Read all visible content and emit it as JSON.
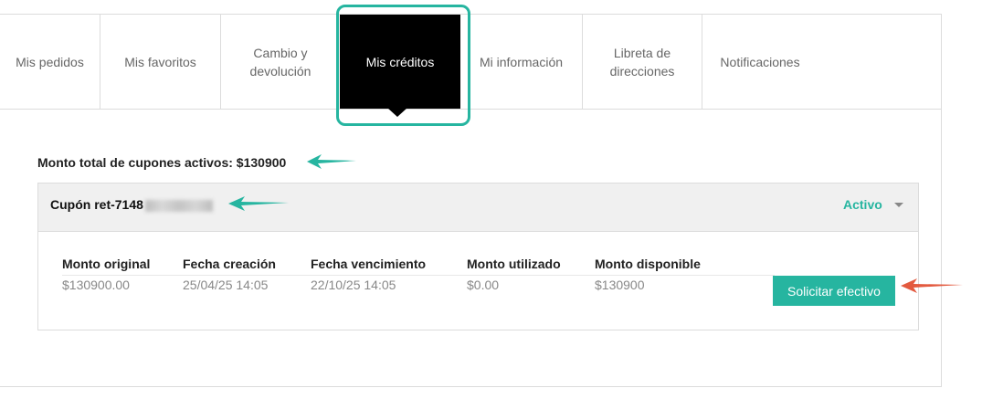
{
  "tabs": [
    {
      "label": "Mis pedidos"
    },
    {
      "label": "Mis favoritos"
    },
    {
      "label_line1": "Cambio y",
      "label_line2": "devolución"
    },
    {
      "label": "Mis créditos"
    },
    {
      "label": "Mi información"
    },
    {
      "label_line1": "Libreta de",
      "label_line2": "direcciones"
    },
    {
      "label": "Notificaciones"
    }
  ],
  "credits": {
    "total_label": "Monto total de cupones activos: $130900"
  },
  "coupon": {
    "id_prefix": "Cupón ret-7148",
    "status": "Activo",
    "columns": [
      "Monto original",
      "Fecha creación",
      "Fecha vencimiento",
      "Monto utilizado",
      "Monto disponible"
    ],
    "values": [
      "$130900.00",
      "25/04/25 14:05",
      "22/10/25 14:05",
      "$0.00",
      "$130900"
    ],
    "action_label": "Solicitar efectivo"
  },
  "colors": {
    "accent": "#26b5a0",
    "annotation_arrow_teal": "#26b5a0",
    "annotation_arrow_red": "#e35a3f",
    "active_tab_bg": "#000000"
  }
}
